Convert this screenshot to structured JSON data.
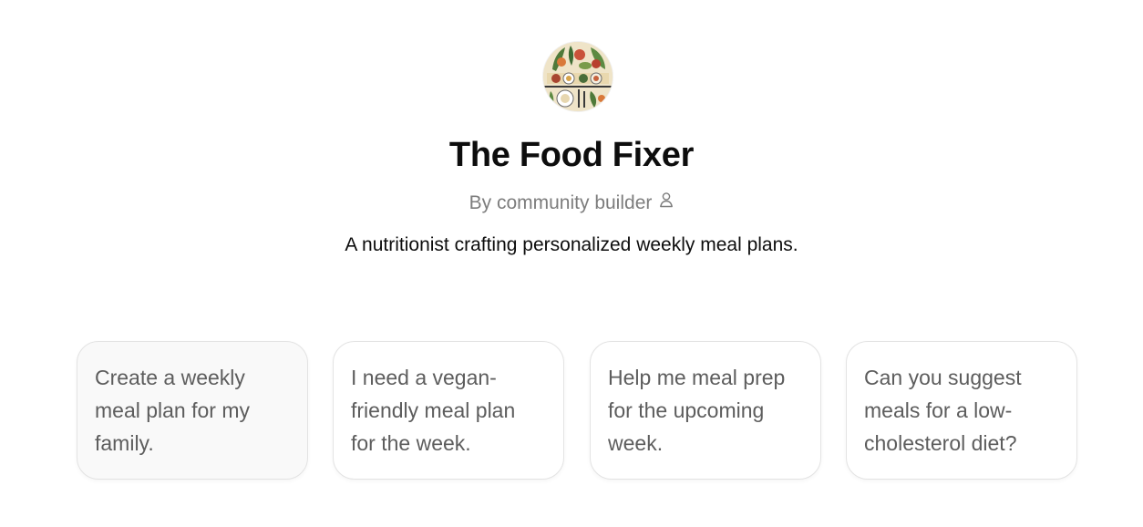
{
  "gpt": {
    "name": "The Food Fixer",
    "byline": "By community builder",
    "description": "A nutritionist crafting personalized weekly meal plans.",
    "avatar_icon": "food-illustration-avatar",
    "byline_icon": "person-icon"
  },
  "starters": [
    {
      "label": "Create a weekly meal plan for my family."
    },
    {
      "label": "I need a vegan-friendly meal plan for the week."
    },
    {
      "label": "Help me meal prep for the upcoming week."
    },
    {
      "label": "Can you suggest meals for a low-cholesterol diet?"
    }
  ],
  "colors": {
    "title": "#0d0d0d",
    "byline": "#7d7d7d",
    "starter_text": "#5d5d5d",
    "starter_border": "#e3e3e3",
    "starter_hover_bg": "#f9f9f9"
  }
}
